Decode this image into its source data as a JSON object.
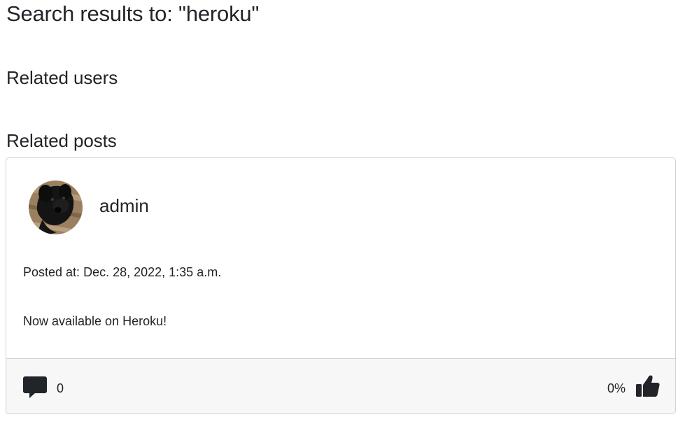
{
  "page": {
    "title": "Search results to: \"heroku\""
  },
  "sections": {
    "users_heading": "Related users",
    "posts_heading": "Related posts"
  },
  "post": {
    "author": "admin",
    "avatar_icon": "dog-photo-avatar",
    "posted_label": "Posted at:",
    "posted_date": "Dec. 28, 2022, 1:35 a.m.",
    "content": "Now available on Heroku!",
    "comment_icon": "comment-icon",
    "comment_count": "0",
    "like_percent": "0%",
    "like_icon": "thumbs-up-icon"
  },
  "colors": {
    "text": "#212529",
    "card_border": "#d2d2d2",
    "footer_bg": "#f7f7f7",
    "icon": "#212529"
  }
}
